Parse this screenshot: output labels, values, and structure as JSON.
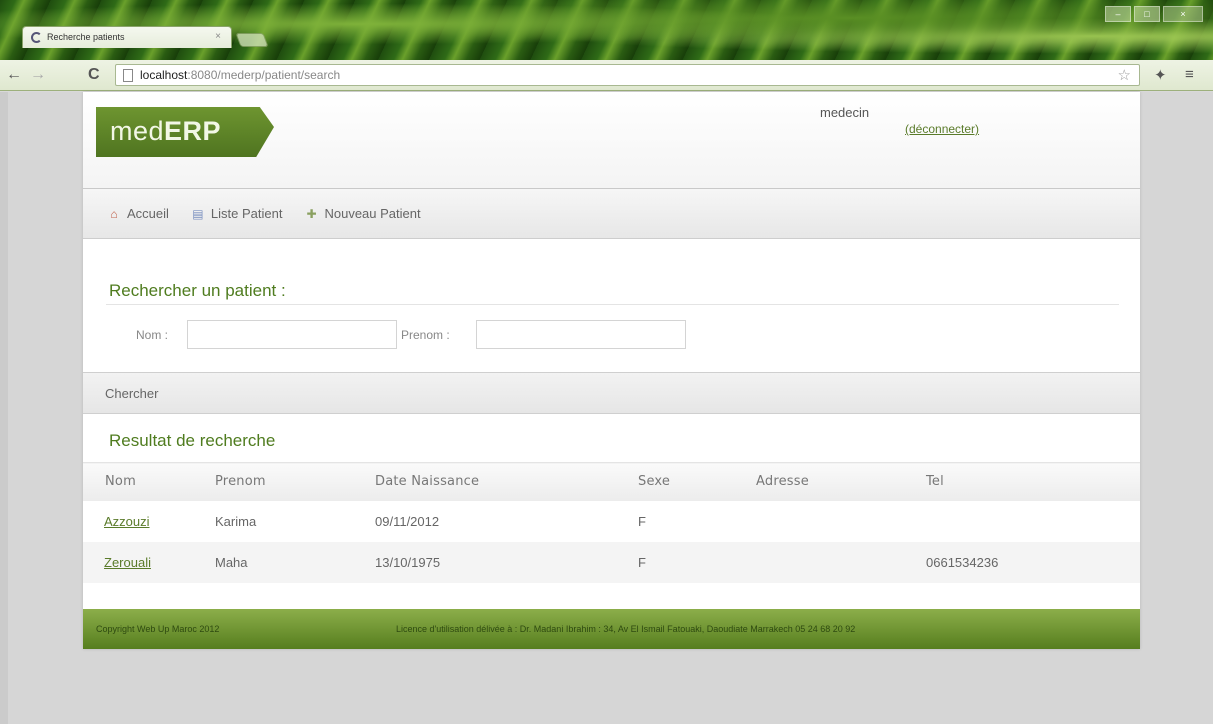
{
  "browser": {
    "tab_title": "Recherche patients",
    "tab_close": "×",
    "url_host": "localhost",
    "url_path": ":8080/mederp/patient/search",
    "window_controls": [
      "–",
      "□",
      "×"
    ]
  },
  "header": {
    "logo_light": "med",
    "logo_bold": "ERP",
    "user": "medecin",
    "logout": "(déconnecter)"
  },
  "menu": {
    "items": [
      {
        "label": "Accueil",
        "icon": "home-icon"
      },
      {
        "label": "Liste Patient",
        "icon": "list-icon"
      },
      {
        "label": "Nouveau Patient",
        "icon": "new-patient-icon"
      }
    ]
  },
  "search": {
    "title": "Rechercher un patient :",
    "nom_label": "Nom :",
    "nom_value": "",
    "prenom_label": "Prenom :",
    "prenom_value": "",
    "button": "Chercher"
  },
  "results": {
    "title": "Resultat de recherche",
    "columns": [
      "Nom",
      "Prenom",
      "Date Naissance",
      "Sexe",
      "Adresse",
      "Tel"
    ],
    "rows": [
      {
        "nom": "Azzouzi",
        "prenom": "Karima",
        "date": "09/11/2012",
        "sexe": "F",
        "adresse": "",
        "tel": ""
      },
      {
        "nom": "Zerouali",
        "prenom": "Maha",
        "date": "13/10/1975",
        "sexe": "F",
        "adresse": "",
        "tel": "0661534236"
      }
    ]
  },
  "footer": {
    "copyright": "Copyright Web Up Maroc 2012",
    "license": "Licence d'utilisation délivée à : Dr. Madani Ibrahim : 34, Av El Ismail Fatouaki, Daoudiate Marrakech 05 24 68 20 92"
  }
}
